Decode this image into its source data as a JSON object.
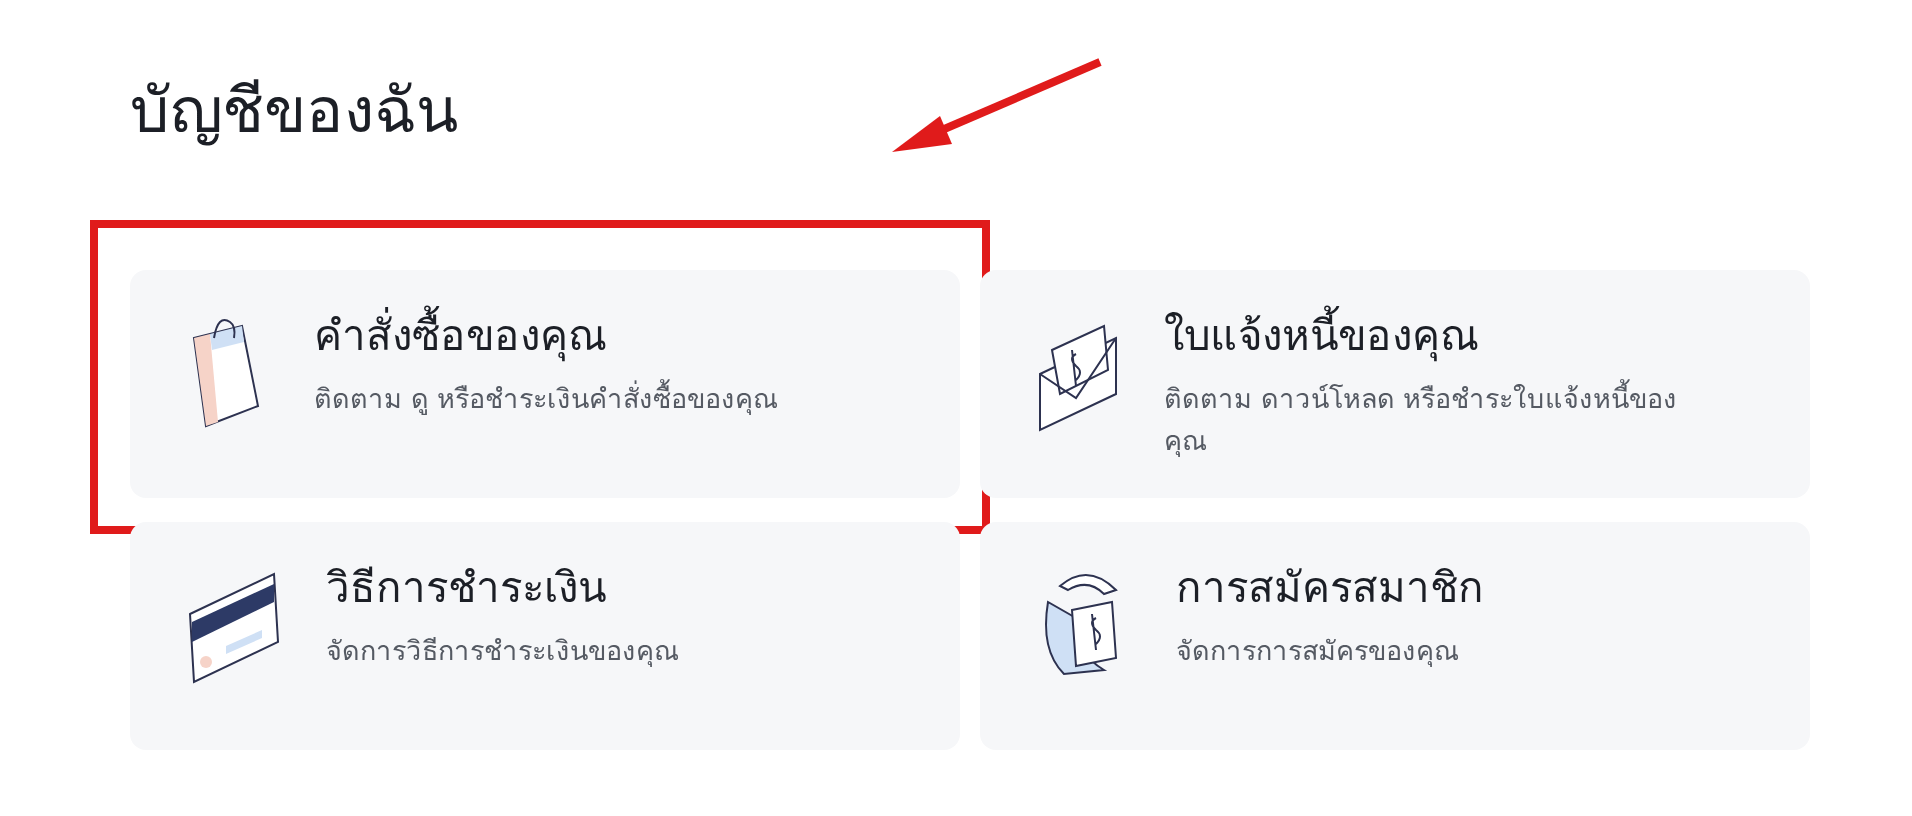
{
  "title": "บัญชีของฉัน",
  "cards": [
    {
      "kind": "bag",
      "title": "คำสั่งซื้อของคุณ",
      "description": "ติดตาม ดู หรือชำระเงินคำสั่งซื้อของคุณ",
      "highlighted": true
    },
    {
      "kind": "invoice",
      "title": "ใบแจ้งหนี้ของคุณ",
      "description": "ติดตาม ดาวน์โหลด หรือชำระใบแจ้งหนี้ของคุณ",
      "highlighted": false
    },
    {
      "kind": "card",
      "title": "วิธีการชำระเงิน",
      "description": "จัดการวิธีการชำระเงินของคุณ",
      "highlighted": false
    },
    {
      "kind": "subscription",
      "title": "การสมัครสมาชิก",
      "description": "จัดการการสมัครของคุณ",
      "highlighted": false
    }
  ]
}
